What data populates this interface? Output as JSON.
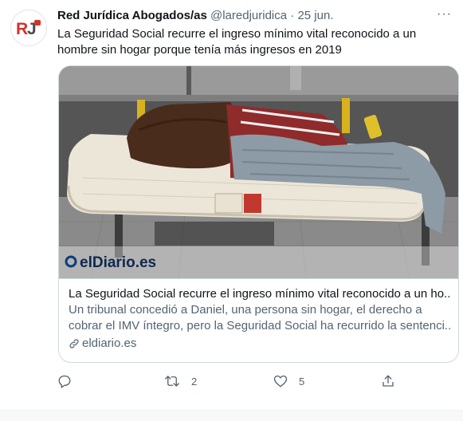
{
  "tweet": {
    "author_name": "Red Jurídica Abogados/as",
    "handle": "@laredjuridica",
    "separator": "·",
    "date": "25 jun.",
    "logo_text": "RJ",
    "more_label": "···",
    "text": "La Seguridad Social recurre el ingreso mínimo vital reconocido a un hombre sin hogar porque tenía más ingresos en 2019"
  },
  "card": {
    "watermark": "elDiario.es",
    "title": "La Seguridad Social recurre el ingreso mínimo vital reconocido a un ho...",
    "description_line1": "Un tribunal concedió a Daniel, una persona sin hogar, el derecho a",
    "description_line2": "cobrar el IMV íntegro, pero la Seguridad Social ha recurrido la sentenci...",
    "domain": "eldiario.es"
  },
  "actions": {
    "reply_icon": "reply-icon",
    "retweet_icon": "retweet-icon",
    "retweet_count": "2",
    "like_icon": "heart-icon",
    "like_count": "5",
    "share_icon": "share-icon"
  },
  "colors": {
    "text_primary": "#0f1419",
    "text_secondary": "#536471",
    "border": "#cfd9de",
    "logo_red": "#d6312b"
  }
}
